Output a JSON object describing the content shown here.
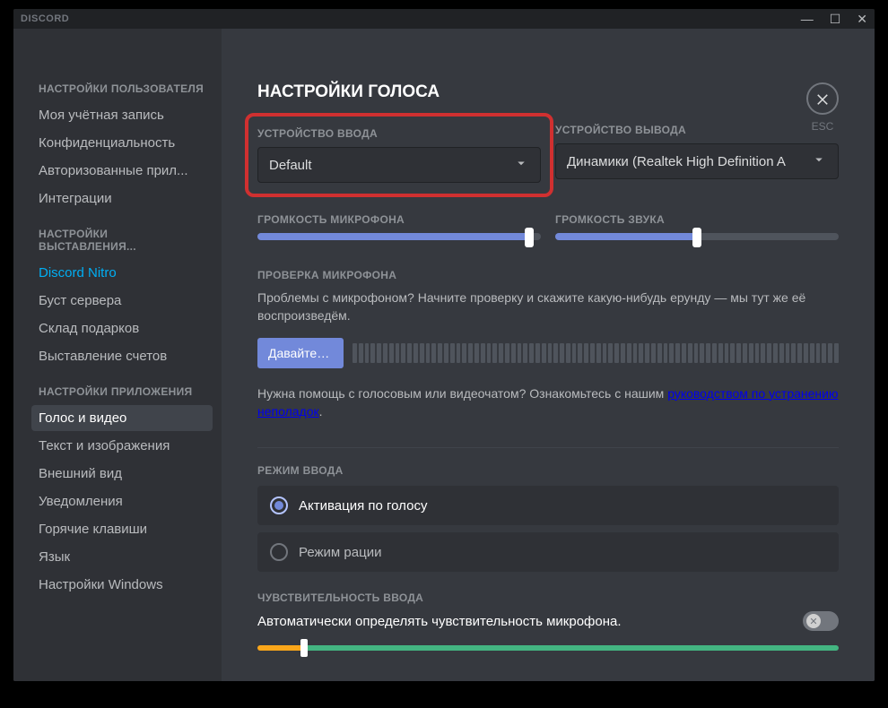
{
  "titlebar": {
    "title": "DISCORD"
  },
  "close": {
    "label": "ESC"
  },
  "sidebar": {
    "sections": [
      {
        "header": "НАСТРОЙКИ ПОЛЬЗОВАТЕЛЯ",
        "items": [
          {
            "label": "Моя учётная запись"
          },
          {
            "label": "Конфиденциальность"
          },
          {
            "label": "Авторизованные прил..."
          },
          {
            "label": "Интеграции"
          }
        ]
      },
      {
        "header": "НАСТРОЙКИ ВЫСТАВЛЕНИЯ...",
        "items": [
          {
            "label": "Discord Nitro",
            "link": true
          },
          {
            "label": "Буст сервера"
          },
          {
            "label": "Склад подарков"
          },
          {
            "label": "Выставление счетов"
          }
        ]
      },
      {
        "header": "НАСТРОЙКИ ПРИЛОЖЕНИЯ",
        "items": [
          {
            "label": "Голос и видео",
            "active": true
          },
          {
            "label": "Текст и изображения"
          },
          {
            "label": "Внешний вид"
          },
          {
            "label": "Уведомления"
          },
          {
            "label": "Горячие клавиши"
          },
          {
            "label": "Язык"
          },
          {
            "label": "Настройки Windows"
          }
        ]
      }
    ]
  },
  "page": {
    "title": "НАСТРОЙКИ ГОЛОСА",
    "input_device": {
      "label": "УСТРОЙСТВО ВВОДА",
      "value": "Default"
    },
    "output_device": {
      "label": "УСТРОЙСТВО ВЫВОДА",
      "value": "Динамики (Realtek High Definition A"
    },
    "mic_volume": {
      "label": "ГРОМКОСТЬ МИКРОФОНА",
      "percent": 96
    },
    "out_volume": {
      "label": "ГРОМКОСТЬ ЗВУКА",
      "percent": 50
    },
    "mic_test": {
      "label": "ПРОВЕРКА МИКРОФОНА",
      "text": "Проблемы с микрофоном? Начните проверку и скажите какую-нибудь ерунду — мы тут же её воспроизведём.",
      "button": "Давайте пр..."
    },
    "help": {
      "prefix": "Нужна помощь с голосовым или видеочатом? Ознакомьтесь с нашим ",
      "link": "руководством по устранению неполадок",
      "suffix": "."
    },
    "input_mode": {
      "label": "РЕЖИМ ВВОДА",
      "options": [
        {
          "label": "Активация по голосу",
          "selected": true
        },
        {
          "label": "Режим рации",
          "selected": false
        }
      ]
    },
    "sensitivity": {
      "label": "ЧУВСТВИТЕЛЬНОСТЬ ВВОДА",
      "auto_label": "Автоматически определять чувствительность микрофона."
    }
  }
}
